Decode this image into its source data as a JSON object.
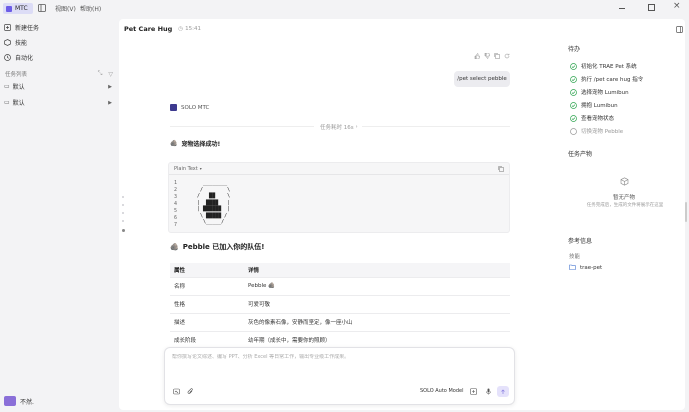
{
  "topbar": {
    "app_button": "MTC",
    "menus": [
      "视图(V)",
      "帮助(H)"
    ]
  },
  "sidebar": {
    "items": [
      {
        "label": "新建任务",
        "icon": "new-task-icon"
      },
      {
        "label": "技能",
        "icon": "skill-icon"
      },
      {
        "label": "自动化",
        "icon": "automation-icon"
      }
    ],
    "task_list_label": "任务列表",
    "folders": [
      {
        "label": "默认"
      },
      {
        "label": "默认"
      }
    ],
    "user_name": "不然."
  },
  "header": {
    "title": "Pet Care Hug",
    "elapsed": "15:41"
  },
  "chat": {
    "user_message": "/pet select pebble",
    "agent_name": "SOLO MTC",
    "task_time": "任务耗时 16s",
    "success_text": "宠物选择成功!",
    "code_lang": "Plain Text",
    "code_lines": [
      "1",
      "2",
      "3",
      "4",
      "5",
      "6",
      "7"
    ],
    "ascii_art": "    ________\n   /        \\\n  /   ██    \\\n  |  ████   |\n  | ██████  |\n   \\ █████ /\n    \\_____/",
    "joined_text": "Pebble 已加入你的队伍!",
    "table_headers": [
      "属性",
      "详情"
    ],
    "table_rows": [
      [
        "名称",
        "Pebble 🪨"
      ],
      [
        "性格",
        "可爱可敬"
      ],
      [
        "描述",
        "灰色的像素石像，安静而坚定，像一座小山"
      ],
      [
        "成长阶段",
        "幼年期（成长中，需要你的照顾）"
      ]
    ]
  },
  "composer": {
    "placeholder": "帮你撰写论文综述、编写 PPT、分析 Excel 等日常工作，输出专业级工作成果。",
    "model": "SOLO Auto Model"
  },
  "right_panel": {
    "todo_title": "待办",
    "todos": [
      {
        "label": "初始化 TRAE Pet 系统",
        "done": true
      },
      {
        "label": "执行 /pet care hug 指令",
        "done": true
      },
      {
        "label": "选择宠物 Lumibun",
        "done": true
      },
      {
        "label": "拥抱 Lumibun",
        "done": true
      },
      {
        "label": "查看宠物状态",
        "done": true
      },
      {
        "label": "切换宠物 Pebble",
        "done": false
      }
    ],
    "artifacts_title": "任务产物",
    "empty_title": "暂无产物",
    "empty_sub": "任务完成后，生成的文件将展示在这里",
    "refs_title": "参考信息",
    "skills_label": "技能",
    "skill_item": "trae-pet"
  },
  "colors": {
    "accent": "#6c5ce7",
    "done_green": "#2ea44f",
    "sidebar_bg": "#f3f3f5"
  }
}
